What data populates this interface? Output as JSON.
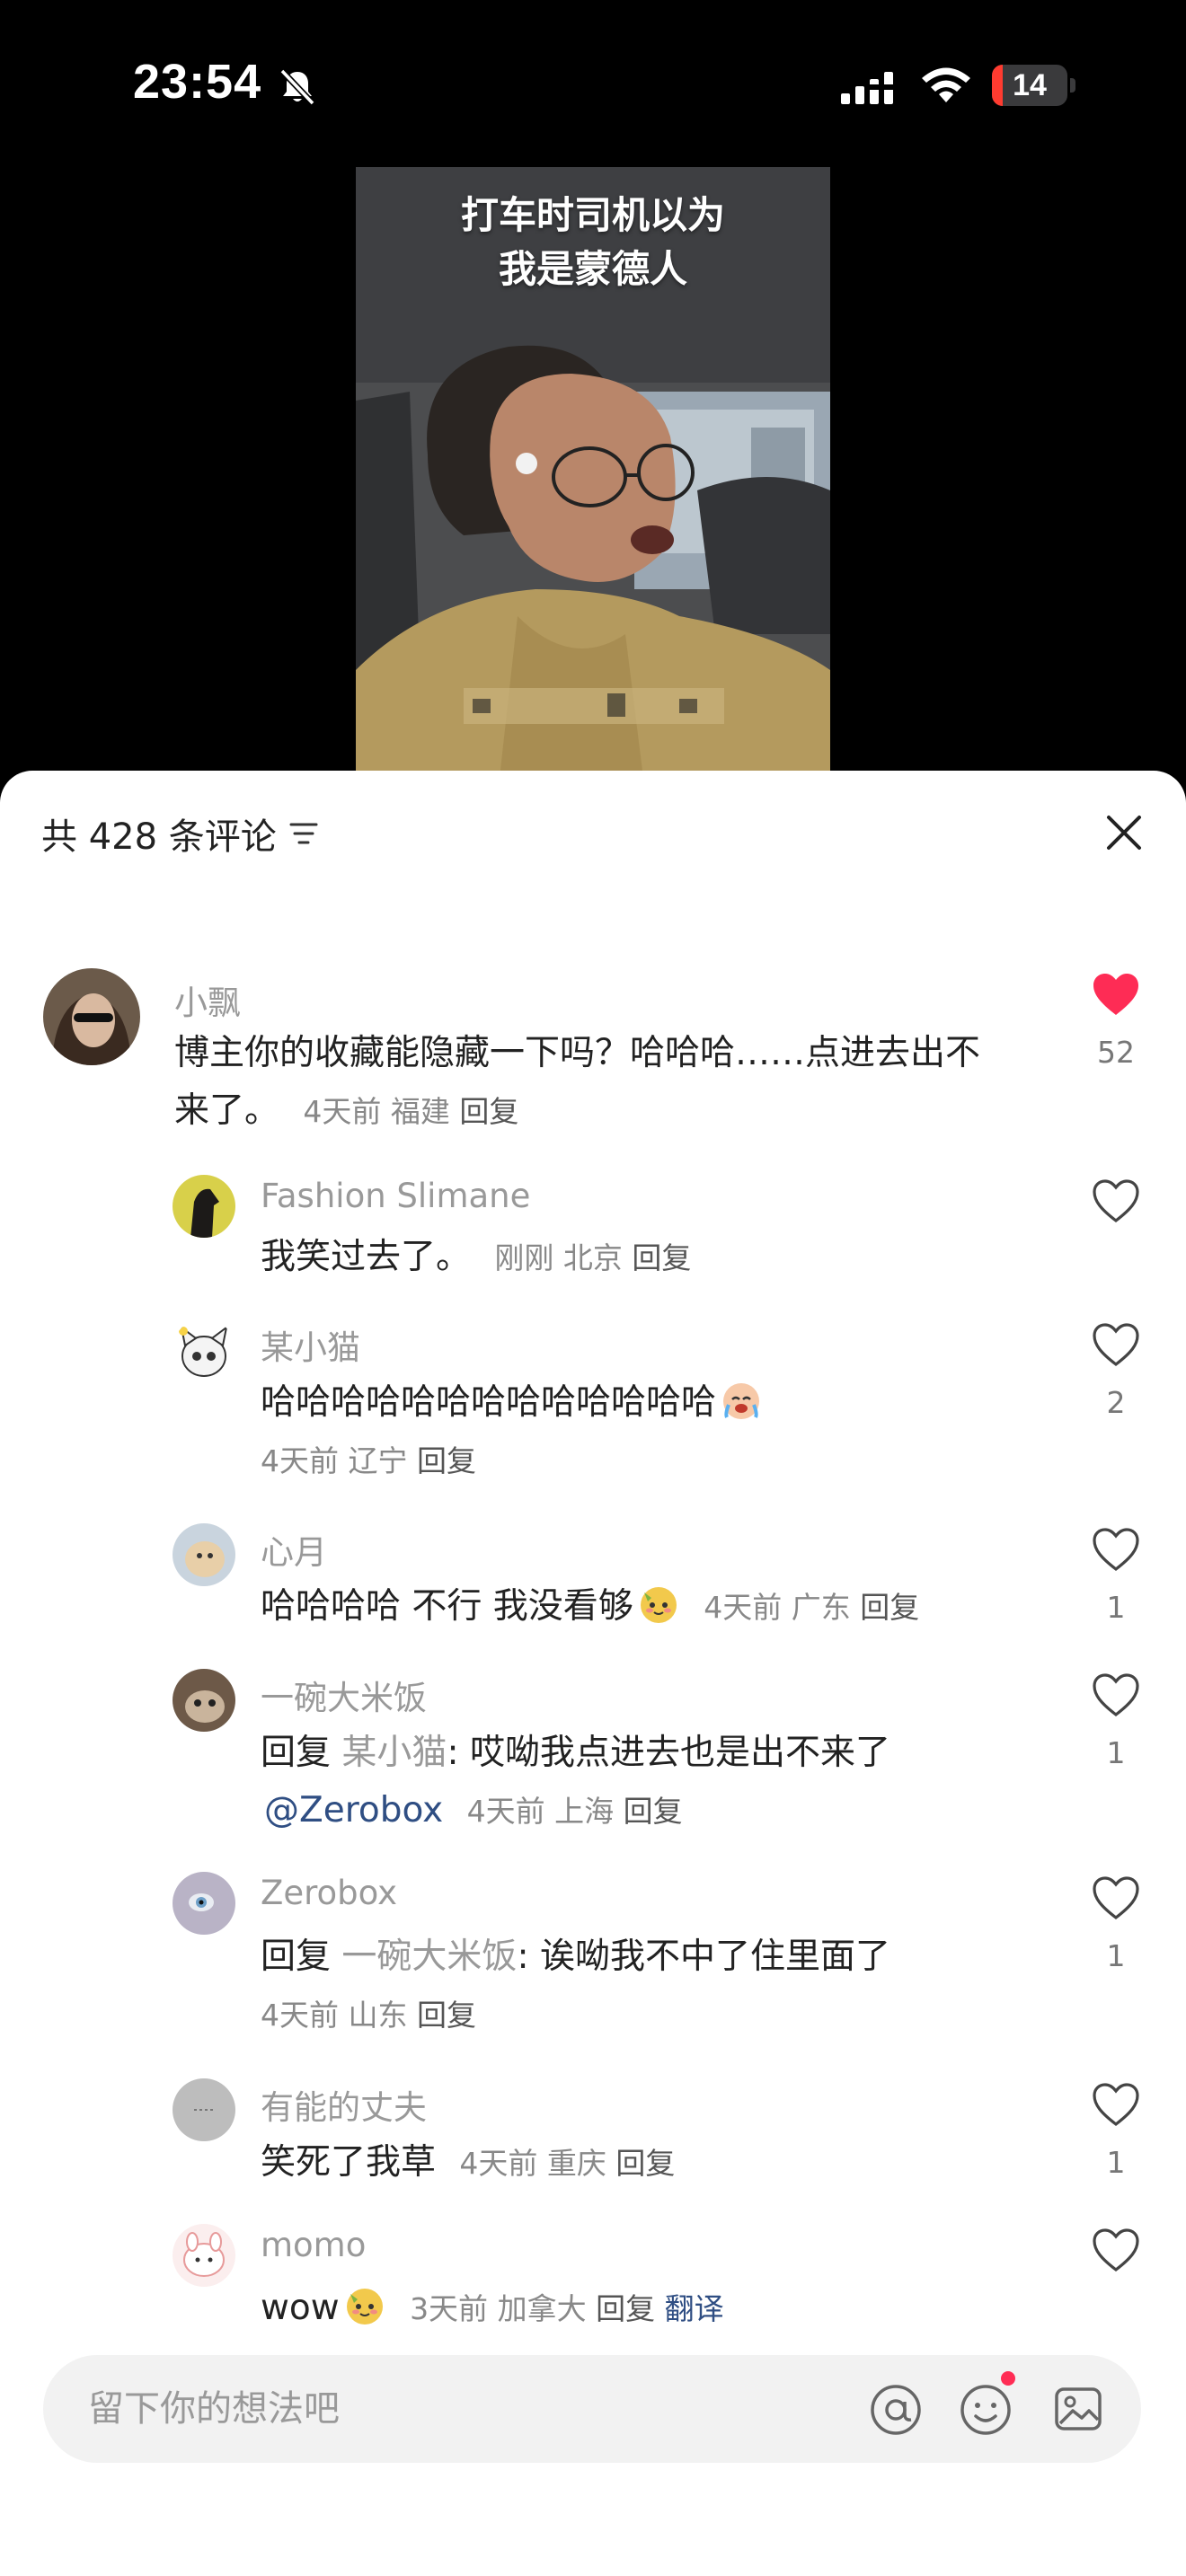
{
  "status_bar": {
    "time": "23:54",
    "battery": "14",
    "battery_level": 0.14,
    "battery_color": "#ff3b30"
  },
  "video": {
    "title_line1": "打车时司机以为",
    "title_line2": "我是蒙德人"
  },
  "comments_panel": {
    "count_label": "共 428 条评论",
    "like_color": "#fe2c55",
    "input_placeholder": "留下你的想法吧"
  },
  "comments": [
    {
      "name": "小飘",
      "text_line1": "博主你的收藏能隐藏一下吗？哈哈哈……点进去出不",
      "text_line2": "来了。",
      "time": "4天前",
      "region": "福建",
      "reply": "回复",
      "likes": "52",
      "liked": true
    },
    {
      "name": "Fashion Slimane",
      "text": "我笑过去了。",
      "time": "刚刚",
      "region": "北京",
      "reply": "回复",
      "likes": ""
    },
    {
      "name": "某小猫",
      "text": "哈哈哈哈哈哈哈哈哈哈哈哈哈",
      "time": "4天前",
      "region": "辽宁",
      "reply": "回复",
      "likes": "2"
    },
    {
      "name": "心月",
      "text": "哈哈哈哈 不行 我没看够",
      "time": "4天前",
      "region": "广东",
      "reply": "回复",
      "likes": "1"
    },
    {
      "name": "一碗大米饭",
      "prefix": "回复",
      "reply_to": "某小猫",
      "text": ": 哎呦我点进去也是出不来了",
      "mention": "@Zerobox",
      "time": "4天前",
      "region": "上海",
      "reply": "回复",
      "likes": "1"
    },
    {
      "name": "Zerobox",
      "prefix": "回复",
      "reply_to": "一碗大米饭",
      "text": ": 诶呦我不中了住里面了",
      "time": "4天前",
      "region": "山东",
      "reply": "回复",
      "likes": "1"
    },
    {
      "name": "有能的丈夫",
      "text": "笑死了我草",
      "time": "4天前",
      "region": "重庆",
      "reply": "回复",
      "likes": "1"
    },
    {
      "name": "momo",
      "text": "wow",
      "time": "3天前",
      "region": "加拿大",
      "reply": "回复",
      "translate": "翻译",
      "likes": ""
    }
  ]
}
